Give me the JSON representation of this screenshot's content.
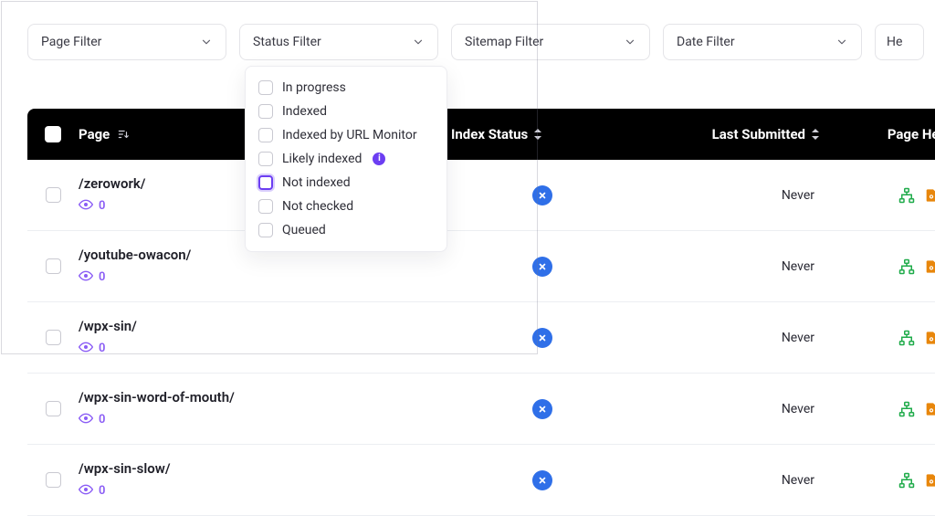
{
  "filters": {
    "page": "Page Filter",
    "status": "Status Filter",
    "sitemap": "Sitemap Filter",
    "date": "Date Filter",
    "health_trunc": "He"
  },
  "status_options": [
    {
      "label": "In progress",
      "selected": false
    },
    {
      "label": "Indexed",
      "selected": false
    },
    {
      "label": "Indexed by URL Monitor",
      "selected": false
    },
    {
      "label": "Likely indexed",
      "selected": false,
      "has_info": true
    },
    {
      "label": "Not indexed",
      "selected": true
    },
    {
      "label": "Not checked",
      "selected": false
    },
    {
      "label": "Queued",
      "selected": false
    }
  ],
  "columns": {
    "page": "Page",
    "index_status": "Index Status",
    "last_submitted": "Last Submitted",
    "page_health": "Page Health"
  },
  "rows": [
    {
      "url": "/zerowork/",
      "views": "0",
      "last_submitted": "Never"
    },
    {
      "url": "/youtube-owacon/",
      "views": "0",
      "last_submitted": "Never"
    },
    {
      "url": "/wpx-sin/",
      "views": "0",
      "last_submitted": "Never"
    },
    {
      "url": "/wpx-sin-word-of-mouth/",
      "views": "0",
      "last_submitted": "Never"
    },
    {
      "url": "/wpx-sin-slow/",
      "views": "0",
      "last_submitted": "Never"
    }
  ],
  "colors": {
    "accent": "#6c3ef2",
    "badge_blue": "#2f6fe8",
    "health_green": "#1fab4a",
    "health_orange": "#e8860b"
  }
}
